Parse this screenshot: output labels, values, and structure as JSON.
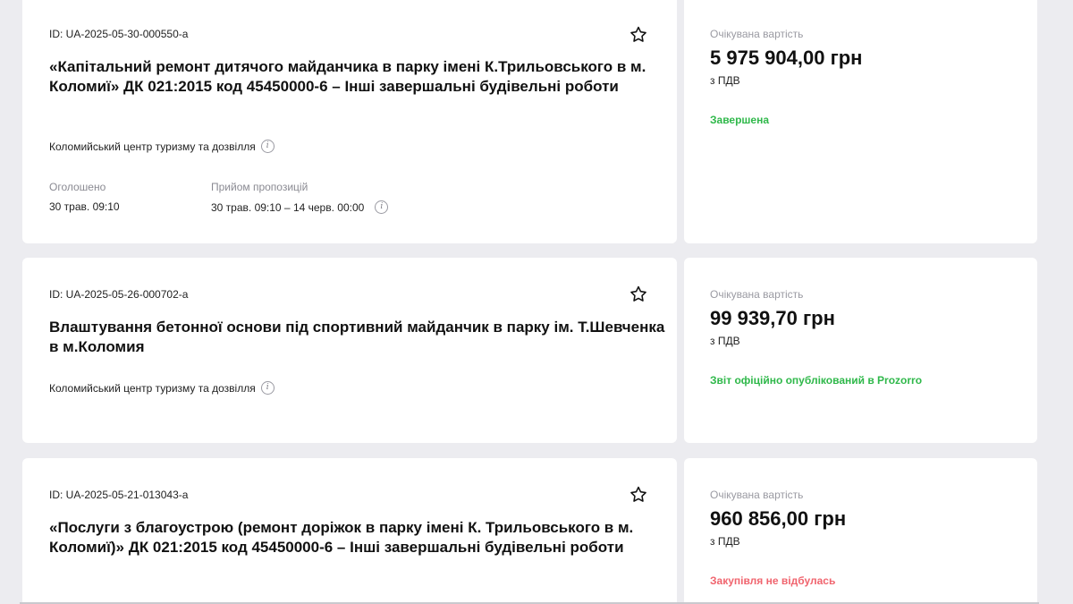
{
  "tenders": [
    {
      "id": "ID: UA-2025-05-30-000550-a",
      "title": "«Капітальний ремонт дитячого майданчика в парку імені К.Трильовського в м. Коломиї» ДК 021:2015 код 45450000-6 – Інші завершальні будівельні роботи",
      "organization": "Коломийський центр туризму та дозвілля",
      "announced_label": "Оголошено",
      "announced_value": "30 трав. 09:10",
      "proposals_label": "Прийом пропозицій",
      "proposals_value": "30 трав. 09:10 – 14 черв. 00:00",
      "expected_label": "Очікувана вартість",
      "amount": "5 975 904,00 грн",
      "vat": "з ПДВ",
      "status": "Завершена",
      "status_color": "#2fb84a"
    },
    {
      "id": "ID: UA-2025-05-26-000702-a",
      "title": "Влаштування бетонної основи під спортивний майданчик в парку ім. Т.Шевченка в м.Коломия",
      "organization": "Коломийський центр туризму та дозвілля",
      "expected_label": "Очікувана вартість",
      "amount": "99 939,70 грн",
      "vat": "з ПДВ",
      "status": "Звіт офіційно опублікований в Prozorro",
      "status_color": "#2fb84a"
    },
    {
      "id": "ID: UA-2025-05-21-013043-a",
      "title": "«Послуги з благоустрою (ремонт доріжок в парку імені К. Трильовського в м. Коломиї)» ДК 021:2015 код 45450000-6 – Інші завершальні будівельні роботи",
      "expected_label": "Очікувана вартість",
      "amount": "960 856,00 грн",
      "vat": "з ПДВ",
      "status": "Закупівля не відбулась",
      "status_color": "#f0646e"
    }
  ],
  "icons": {
    "star": "star-outline-icon",
    "info": "info-icon"
  }
}
